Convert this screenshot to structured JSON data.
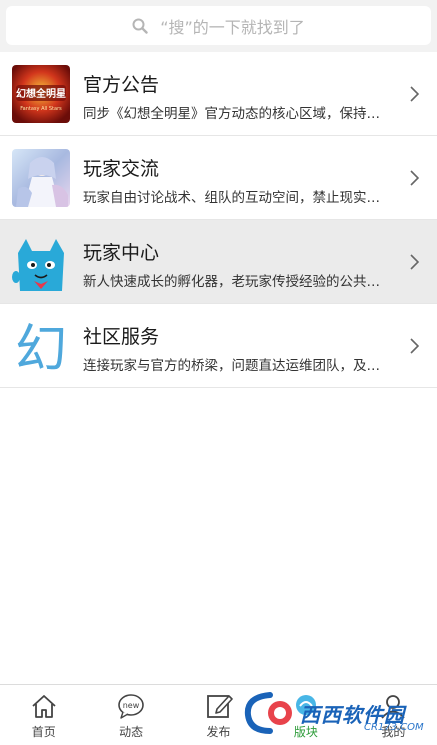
{
  "search": {
    "placeholder": "“搜”的一下就找到了"
  },
  "forums": [
    {
      "title": "官方公告",
      "desc": "同步《幻想全明星》官方动态的核心区域，保持更新资讯"
    },
    {
      "title": "玩家交流",
      "desc": "玩家自由讨论战术、组队的互动空间，禁止现实交易"
    },
    {
      "title": "玩家中心",
      "desc": "新人快速成长的孵化器，老玩家传授经验的公共平台"
    },
    {
      "title": "社区服务",
      "desc": "连接玩家与官方的桥梁，问题直达运维团队，及时处理"
    }
  ],
  "thumb_text": {
    "logo_main": "幻想全明星",
    "logo_sub": "Fantasy All Stars",
    "glyph": "幻"
  },
  "tabbar": {
    "tabs": [
      {
        "label": "首页",
        "icon": "home-icon"
      },
      {
        "label": "动态",
        "icon": "new-bubble-icon",
        "badge": "new"
      },
      {
        "label": "发布",
        "icon": "edit-icon"
      },
      {
        "label": "版块",
        "icon": "board-icon"
      },
      {
        "label": "我的",
        "icon": "profile-icon"
      }
    ],
    "active_index": 3
  },
  "watermark": {
    "title": "西西软件园",
    "sub": "CR173.COM"
  },
  "colors": {
    "active_tab": "#2e9c3a",
    "active_row": "#ebebeb",
    "brand_blue": "#1a63b8"
  }
}
